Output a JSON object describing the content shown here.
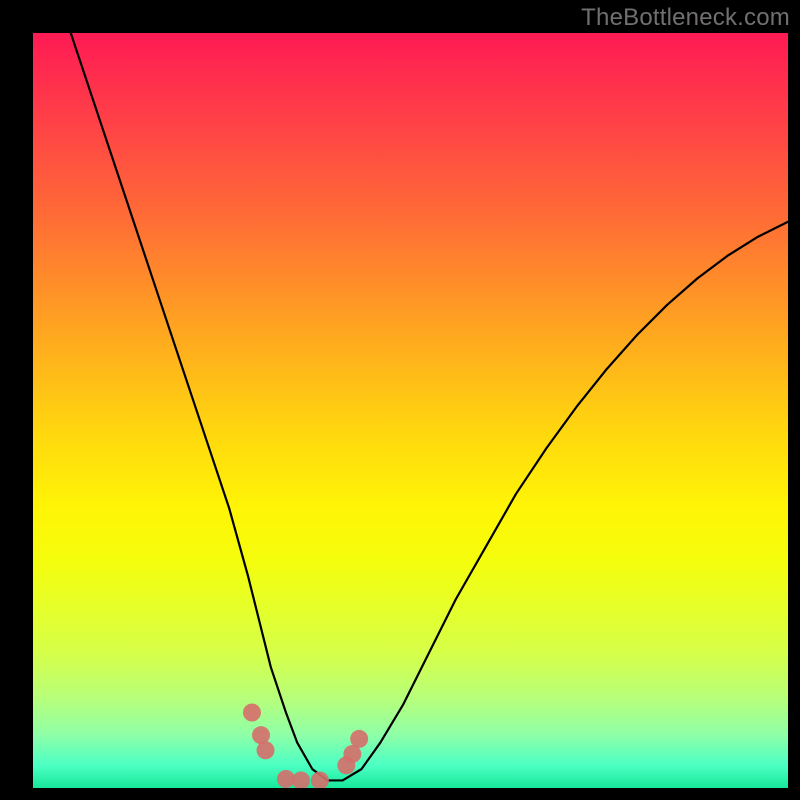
{
  "watermark": "TheBottleneck.com",
  "chart_data": {
    "type": "line",
    "title": "",
    "xlabel": "",
    "ylabel": "",
    "xlim": [
      0,
      100
    ],
    "ylim": [
      0,
      100
    ],
    "grid": false,
    "legend": false,
    "series": [
      {
        "name": "curve",
        "color": "#000000",
        "x": [
          5,
          8,
          11,
          14,
          17,
          20,
          23,
          26,
          28.5,
          30,
          31.5,
          33.5,
          35,
          37,
          39,
          41,
          43.5,
          46,
          49,
          52,
          56,
          60,
          64,
          68,
          72,
          76,
          80,
          84,
          88,
          92,
          96,
          100
        ],
        "y": [
          100,
          91,
          82,
          73,
          64,
          55,
          46,
          37,
          28,
          22,
          16,
          10,
          6,
          2.5,
          1,
          1,
          2.5,
          6,
          11,
          17,
          25,
          32,
          39,
          45,
          50.5,
          55.5,
          60,
          64,
          67.5,
          70.5,
          73,
          75
        ]
      },
      {
        "name": "markers",
        "type": "scatter",
        "color": "#d66e6a",
        "x": [
          29.0,
          30.2,
          30.8,
          33.5,
          35.5,
          38.0,
          41.5,
          42.3,
          43.2
        ],
        "y": [
          10.0,
          7.0,
          5.0,
          1.2,
          1.0,
          1.0,
          3.0,
          4.5,
          6.5
        ]
      }
    ],
    "background_gradient": {
      "top_color": "#ff1a54",
      "bottom_color": "#17e89a"
    }
  }
}
